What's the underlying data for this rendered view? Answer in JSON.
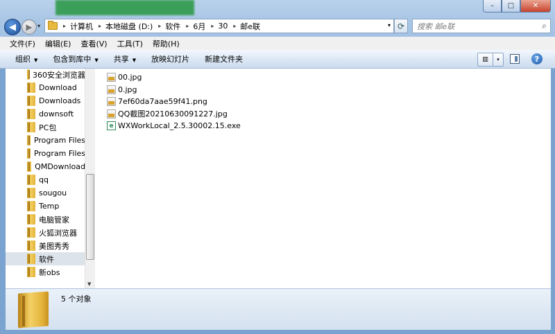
{
  "window": {
    "controls": {
      "minimize": "–",
      "maximize": "□",
      "close": "✕"
    }
  },
  "nav": {
    "back_glyph": "◀",
    "forward_glyph": "▶",
    "address": {
      "crumbs": [
        "计算机",
        "本地磁盘 (D:)",
        "软件",
        "6月",
        "30",
        "邮e联"
      ],
      "separator": "▸",
      "dropdown_glyph": "▾"
    },
    "refresh_glyph": "⟳",
    "search": {
      "placeholder": "搜索 邮e联",
      "icon": "magnifier-icon"
    }
  },
  "menu": [
    "文件(F)",
    "编辑(E)",
    "查看(V)",
    "工具(T)",
    "帮助(H)"
  ],
  "commands": [
    {
      "label": "组织",
      "has_dropdown": true
    },
    {
      "label": "包含到库中",
      "has_dropdown": true
    },
    {
      "label": "共享",
      "has_dropdown": true
    },
    {
      "label": "放映幻灯片",
      "has_dropdown": false
    },
    {
      "label": "新建文件夹",
      "has_dropdown": false
    }
  ],
  "sidebar": {
    "items": [
      {
        "label": "360安全浏览器"
      },
      {
        "label": "Download"
      },
      {
        "label": "Downloads"
      },
      {
        "label": "downsoft"
      },
      {
        "label": "PC包"
      },
      {
        "label": "Program Files"
      },
      {
        "label": "Program Files"
      },
      {
        "label": "QMDownload"
      },
      {
        "label": "qq"
      },
      {
        "label": "sougou"
      },
      {
        "label": "Temp"
      },
      {
        "label": "电脑管家"
      },
      {
        "label": "火狐浏览器"
      },
      {
        "label": "美图秀秀"
      },
      {
        "label": "软件",
        "selected": true
      },
      {
        "label": "新obs"
      }
    ]
  },
  "files": [
    {
      "name": "00.jpg",
      "type": "image"
    },
    {
      "name": "0.jpg",
      "type": "image"
    },
    {
      "name": "7ef60da7aae59f41.png",
      "type": "image"
    },
    {
      "name": "QQ截图20210630091227.jpg",
      "type": "image"
    },
    {
      "name": "WXWorkLocal_2.5.30002.15.exe",
      "type": "exe"
    }
  ],
  "details": {
    "count_text": "5 个对象"
  },
  "colors": {
    "chrome": "#a9c6e6",
    "close": "#c7432d",
    "selected": "#dde3ea",
    "folder": "#e7b93e"
  }
}
